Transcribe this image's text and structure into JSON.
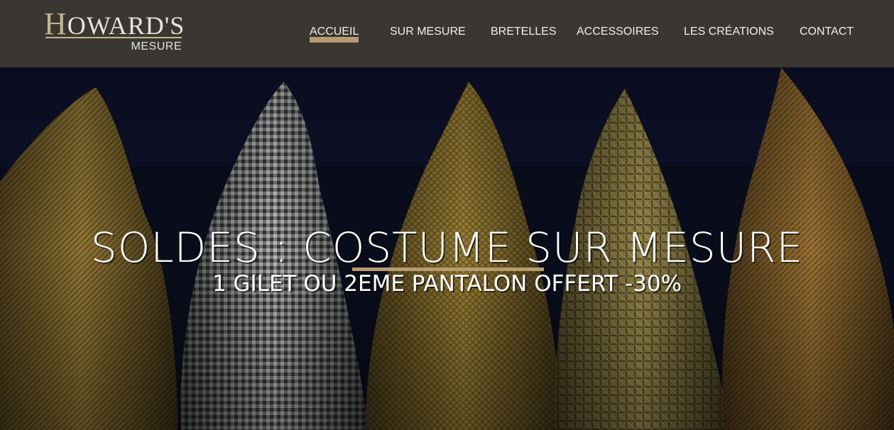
{
  "brand": {
    "logo_main": "HOWARD'S",
    "logo_sub": "MESURE"
  },
  "nav": {
    "items": [
      {
        "label": "ACCUEIL",
        "active": true
      },
      {
        "label": "SUR MESURE",
        "active": false
      },
      {
        "label": "BRETELLES",
        "active": false
      },
      {
        "label": "ACCESSOIRES",
        "active": false
      },
      {
        "label": "LES CRÉATIONS",
        "active": false
      },
      {
        "label": "CONTACT",
        "active": false
      }
    ]
  },
  "hero": {
    "headline": "SOLDES : COSTUME SUR MESURE",
    "subline": "1 GILET OU 2EME PANTALON OFFERT -30%",
    "image": "tweed-jackets-on-rack"
  },
  "colors": {
    "header_bg": "#3a3733",
    "accent": "#b89c6f",
    "text_light": "#f2efe8"
  }
}
